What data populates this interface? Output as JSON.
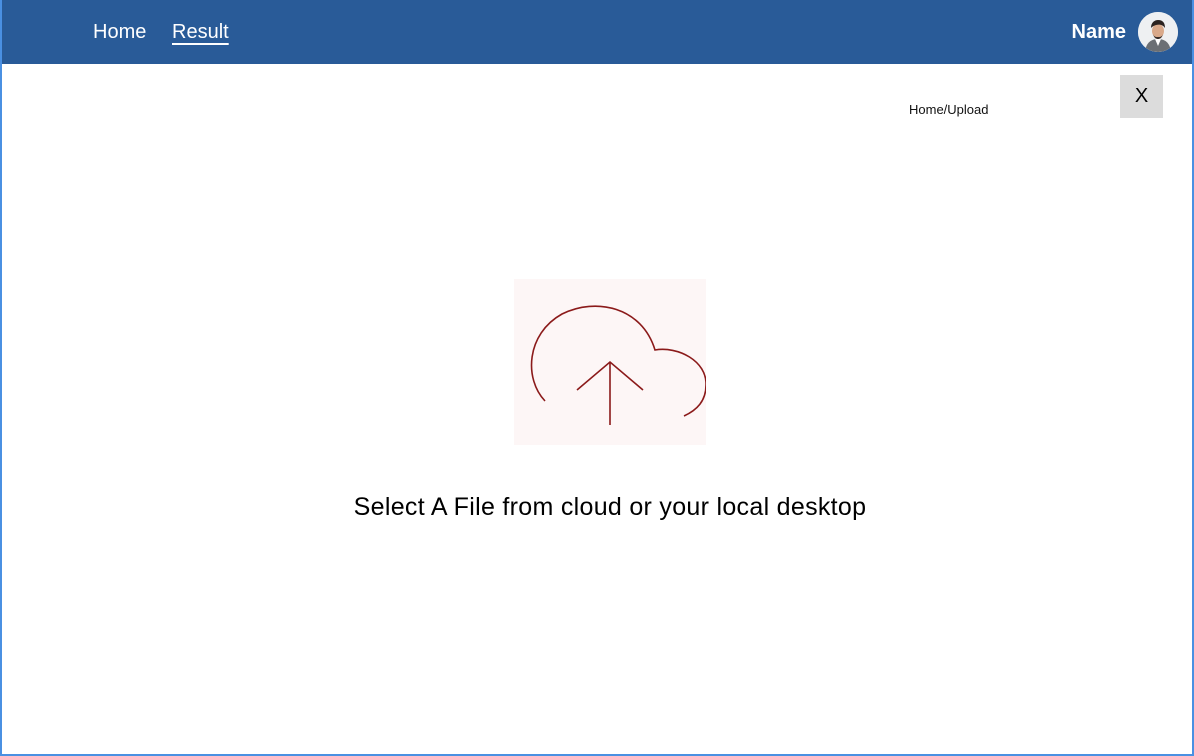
{
  "header": {
    "nav": {
      "home_label": "Home",
      "result_label": "Result"
    },
    "user": {
      "name": "Name",
      "avatar_icon": "user-avatar-icon"
    },
    "background_color": "#295b98"
  },
  "breadcrumb": {
    "text": "Home/Upload"
  },
  "close_button": {
    "label": "X"
  },
  "upload": {
    "icon": "cloud-upload-icon",
    "prompt": "Select A File from cloud or your local desktop",
    "icon_color": "#8b1a1a"
  }
}
